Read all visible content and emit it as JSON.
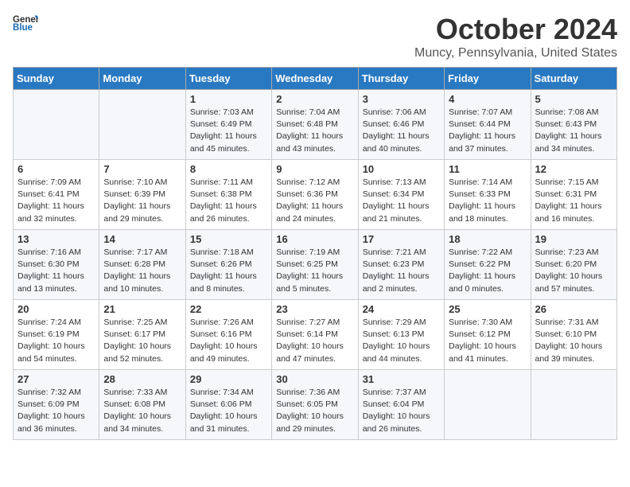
{
  "header": {
    "logo_general": "General",
    "logo_blue": "Blue",
    "title": "October 2024",
    "location": "Muncy, Pennsylvania, United States"
  },
  "days_of_week": [
    "Sunday",
    "Monday",
    "Tuesday",
    "Wednesday",
    "Thursday",
    "Friday",
    "Saturday"
  ],
  "weeks": [
    [
      {
        "day": "",
        "info": ""
      },
      {
        "day": "",
        "info": ""
      },
      {
        "day": "1",
        "info": "Sunrise: 7:03 AM\nSunset: 6:49 PM\nDaylight: 11 hours and 45 minutes."
      },
      {
        "day": "2",
        "info": "Sunrise: 7:04 AM\nSunset: 6:48 PM\nDaylight: 11 hours and 43 minutes."
      },
      {
        "day": "3",
        "info": "Sunrise: 7:06 AM\nSunset: 6:46 PM\nDaylight: 11 hours and 40 minutes."
      },
      {
        "day": "4",
        "info": "Sunrise: 7:07 AM\nSunset: 6:44 PM\nDaylight: 11 hours and 37 minutes."
      },
      {
        "day": "5",
        "info": "Sunrise: 7:08 AM\nSunset: 6:43 PM\nDaylight: 11 hours and 34 minutes."
      }
    ],
    [
      {
        "day": "6",
        "info": "Sunrise: 7:09 AM\nSunset: 6:41 PM\nDaylight: 11 hours and 32 minutes."
      },
      {
        "day": "7",
        "info": "Sunrise: 7:10 AM\nSunset: 6:39 PM\nDaylight: 11 hours and 29 minutes."
      },
      {
        "day": "8",
        "info": "Sunrise: 7:11 AM\nSunset: 6:38 PM\nDaylight: 11 hours and 26 minutes."
      },
      {
        "day": "9",
        "info": "Sunrise: 7:12 AM\nSunset: 6:36 PM\nDaylight: 11 hours and 24 minutes."
      },
      {
        "day": "10",
        "info": "Sunrise: 7:13 AM\nSunset: 6:34 PM\nDaylight: 11 hours and 21 minutes."
      },
      {
        "day": "11",
        "info": "Sunrise: 7:14 AM\nSunset: 6:33 PM\nDaylight: 11 hours and 18 minutes."
      },
      {
        "day": "12",
        "info": "Sunrise: 7:15 AM\nSunset: 6:31 PM\nDaylight: 11 hours and 16 minutes."
      }
    ],
    [
      {
        "day": "13",
        "info": "Sunrise: 7:16 AM\nSunset: 6:30 PM\nDaylight: 11 hours and 13 minutes."
      },
      {
        "day": "14",
        "info": "Sunrise: 7:17 AM\nSunset: 6:28 PM\nDaylight: 11 hours and 10 minutes."
      },
      {
        "day": "15",
        "info": "Sunrise: 7:18 AM\nSunset: 6:26 PM\nDaylight: 11 hours and 8 minutes."
      },
      {
        "day": "16",
        "info": "Sunrise: 7:19 AM\nSunset: 6:25 PM\nDaylight: 11 hours and 5 minutes."
      },
      {
        "day": "17",
        "info": "Sunrise: 7:21 AM\nSunset: 6:23 PM\nDaylight: 11 hours and 2 minutes."
      },
      {
        "day": "18",
        "info": "Sunrise: 7:22 AM\nSunset: 6:22 PM\nDaylight: 11 hours and 0 minutes."
      },
      {
        "day": "19",
        "info": "Sunrise: 7:23 AM\nSunset: 6:20 PM\nDaylight: 10 hours and 57 minutes."
      }
    ],
    [
      {
        "day": "20",
        "info": "Sunrise: 7:24 AM\nSunset: 6:19 PM\nDaylight: 10 hours and 54 minutes."
      },
      {
        "day": "21",
        "info": "Sunrise: 7:25 AM\nSunset: 6:17 PM\nDaylight: 10 hours and 52 minutes."
      },
      {
        "day": "22",
        "info": "Sunrise: 7:26 AM\nSunset: 6:16 PM\nDaylight: 10 hours and 49 minutes."
      },
      {
        "day": "23",
        "info": "Sunrise: 7:27 AM\nSunset: 6:14 PM\nDaylight: 10 hours and 47 minutes."
      },
      {
        "day": "24",
        "info": "Sunrise: 7:29 AM\nSunset: 6:13 PM\nDaylight: 10 hours and 44 minutes."
      },
      {
        "day": "25",
        "info": "Sunrise: 7:30 AM\nSunset: 6:12 PM\nDaylight: 10 hours and 41 minutes."
      },
      {
        "day": "26",
        "info": "Sunrise: 7:31 AM\nSunset: 6:10 PM\nDaylight: 10 hours and 39 minutes."
      }
    ],
    [
      {
        "day": "27",
        "info": "Sunrise: 7:32 AM\nSunset: 6:09 PM\nDaylight: 10 hours and 36 minutes."
      },
      {
        "day": "28",
        "info": "Sunrise: 7:33 AM\nSunset: 6:08 PM\nDaylight: 10 hours and 34 minutes."
      },
      {
        "day": "29",
        "info": "Sunrise: 7:34 AM\nSunset: 6:06 PM\nDaylight: 10 hours and 31 minutes."
      },
      {
        "day": "30",
        "info": "Sunrise: 7:36 AM\nSunset: 6:05 PM\nDaylight: 10 hours and 29 minutes."
      },
      {
        "day": "31",
        "info": "Sunrise: 7:37 AM\nSunset: 6:04 PM\nDaylight: 10 hours and 26 minutes."
      },
      {
        "day": "",
        "info": ""
      },
      {
        "day": "",
        "info": ""
      }
    ]
  ]
}
